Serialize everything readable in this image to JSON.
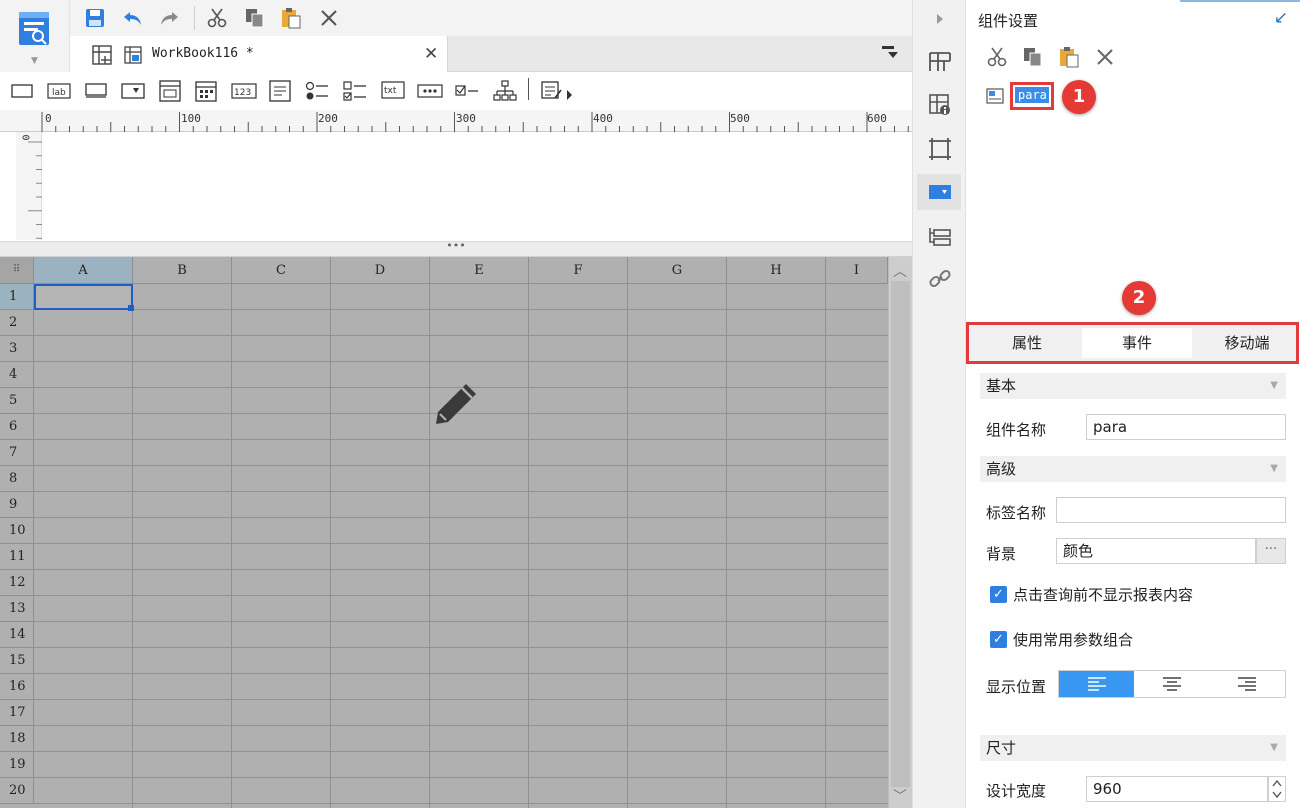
{
  "app": {
    "logo_icon": "report-designer-logo-icon",
    "accent": "#2a73c9"
  },
  "toolbar": {
    "icons": [
      "save-icon",
      "undo-icon",
      "redo-icon",
      "cut-icon",
      "copy-icon",
      "paste-icon",
      "delete-icon"
    ]
  },
  "tab": {
    "title": "WorkBook116 *",
    "close_glyph": "✕"
  },
  "ruler": {
    "labels": [
      "0",
      "100",
      "200",
      "300",
      "400",
      "500",
      "600"
    ],
    "vlabel": "0"
  },
  "splitter": {
    "glyph": "•••"
  },
  "sheet": {
    "columns": [
      "A",
      "B",
      "C",
      "D",
      "E",
      "F",
      "G",
      "H",
      "I"
    ],
    "rows": [
      "1",
      "2",
      "3",
      "4",
      "5",
      "6",
      "7",
      "8",
      "9",
      "10",
      "11",
      "12",
      "13",
      "14",
      "15",
      "16",
      "17",
      "18",
      "19",
      "20"
    ],
    "selected_cell": "A1"
  },
  "panel": {
    "title": "组件设置",
    "component_name": "para",
    "badge_1": "1",
    "badge_2": "2",
    "tabs": [
      "属性",
      "事件",
      "移动端"
    ],
    "sections": {
      "basic": "基本",
      "advanced": "高级",
      "size": "尺寸"
    },
    "fields": {
      "component_name_label": "组件名称",
      "component_name_value": "para",
      "label_name_label": "标签名称",
      "label_name_value": "",
      "background_label": "背景",
      "background_value": "颜色",
      "dots": "···",
      "checkbox1": "点击查询前不显示报表内容",
      "checkbox2": "使用常用参数组合",
      "display_position_label": "显示位置",
      "design_width_label": "设计宽度",
      "design_width_value": "960"
    },
    "checkbox_glyph": "✓",
    "caret_glyph": "▼",
    "colors": {
      "highlight": "#e33b3b",
      "selected": "#3897f0"
    }
  }
}
